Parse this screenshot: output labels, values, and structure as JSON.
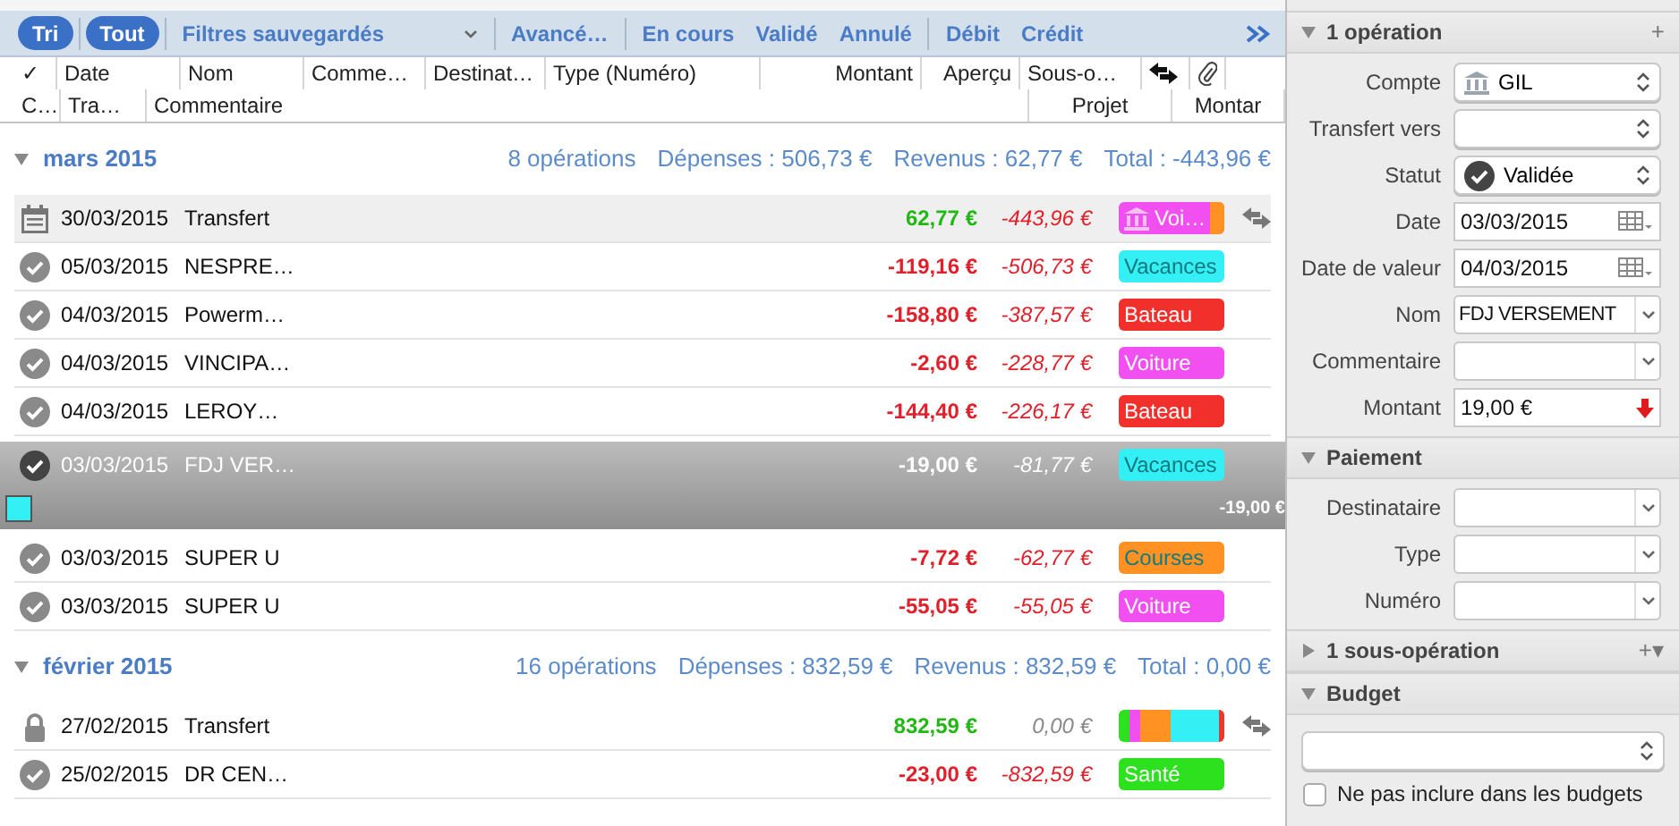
{
  "toolbar": {
    "filters": [
      {
        "label": "Tri",
        "kind": "pill",
        "selected": true
      },
      {
        "label": "Tout",
        "kind": "pill",
        "selected": true
      },
      {
        "label": "Filtres sauvegardés",
        "kind": "menu",
        "selected": false
      },
      {
        "label": "Avancé…",
        "kind": "text",
        "selected": false
      },
      {
        "label": "En cours",
        "kind": "text",
        "selected": false
      },
      {
        "label": "Validé",
        "kind": "text",
        "selected": false
      },
      {
        "label": "Annulé",
        "kind": "text",
        "selected": false
      },
      {
        "label": "Débit",
        "kind": "text",
        "selected": false
      },
      {
        "label": "Crédit",
        "kind": "text",
        "selected": false
      }
    ]
  },
  "columns": {
    "line_1": [
      {
        "label": "✓",
        "kind": "text"
      },
      {
        "label": "Date",
        "kind": "text"
      },
      {
        "label": "Nom",
        "kind": "text"
      },
      {
        "label": "Comme…",
        "kind": "text"
      },
      {
        "label": "Destinat…",
        "kind": "text"
      },
      {
        "label": "Type (Numéro)",
        "kind": "text"
      },
      {
        "label": "Montant",
        "kind": "text"
      },
      {
        "label": "Aperçu",
        "kind": "text"
      },
      {
        "label": "Sous-o…",
        "kind": "text"
      },
      {
        "kind": "transfer"
      },
      {
        "kind": "attachment"
      }
    ],
    "line_2": [
      {
        "label": "C…"
      },
      {
        "label": "Tra…"
      },
      {
        "label": "Commentaire"
      },
      {
        "label": "Projet"
      },
      {
        "label": "Montar"
      }
    ]
  },
  "groups": [
    {
      "title": "mars 2015",
      "expanded": true,
      "count": "8 opérations",
      "expenses": "Dépenses : 506,73 €",
      "income": "Revenus : 62,77 €",
      "total": "Total : -443,96 €",
      "rows": [
        {
          "kind": "calendar",
          "date": "30/03/2015",
          "name": "Transfert",
          "amount": "62,77 €",
          "credit": true,
          "balance": "-443,96 €",
          "balance_zero": false,
          "tag": {
            "kind": "account",
            "label": "Voi…",
            "color": "#f24ff0",
            "stripes": [
              {
                "color": "#ff9222",
                "kind": "edge"
              }
            ]
          },
          "transfer": true,
          "selected": false
        },
        {
          "kind": "check",
          "date": "05/03/2015",
          "name": "NESPRE…",
          "amount": "-119,16 €",
          "credit": false,
          "balance": "-506,73 €",
          "balance_zero": false,
          "tag": {
            "kind": "category",
            "label": "Vacances",
            "color": "#34f0f5"
          },
          "transfer": false,
          "selected": false
        },
        {
          "kind": "check",
          "date": "04/03/2015",
          "name": "Powerm…",
          "amount": "-158,80 €",
          "credit": false,
          "balance": "-387,57 €",
          "balance_zero": false,
          "tag": {
            "kind": "category",
            "label": "Bateau",
            "color": "#f1302b"
          },
          "transfer": false,
          "selected": false
        },
        {
          "kind": "check",
          "date": "04/03/2015",
          "name": "VINCIPA…",
          "amount": "-2,60 €",
          "credit": false,
          "balance": "-228,77 €",
          "balance_zero": false,
          "tag": {
            "kind": "category",
            "label": "Voiture",
            "color": "#f24ff0"
          },
          "transfer": false,
          "selected": false
        },
        {
          "kind": "check",
          "date": "04/03/2015",
          "name": "LEROY…",
          "amount": "-144,40 €",
          "credit": false,
          "balance": "-226,17 €",
          "balance_zero": false,
          "tag": {
            "kind": "category",
            "label": "Bateau",
            "color": "#f1302b"
          },
          "transfer": false,
          "selected": false
        },
        {
          "kind": "check",
          "date": "03/03/2015",
          "name": "FDJ VER…",
          "amount": "-19,00 €",
          "credit": false,
          "balance": "-81,77 €",
          "balance_zero": false,
          "tag": {
            "kind": "category",
            "label": "Vacances",
            "color": "#34f0f5"
          },
          "transfer": false,
          "selected": true,
          "detail": {
            "color": "#34f0f5",
            "amount": "-19,00 €"
          }
        },
        {
          "kind": "check",
          "date": "03/03/2015",
          "name": "SUPER U",
          "amount": "-7,72 €",
          "credit": false,
          "balance": "-62,77 €",
          "balance_zero": false,
          "tag": {
            "kind": "category",
            "label": "Courses",
            "color": "#ff9222"
          },
          "transfer": false,
          "selected": false
        },
        {
          "kind": "check",
          "date": "03/03/2015",
          "name": "SUPER U",
          "amount": "-55,05 €",
          "credit": false,
          "balance": "-55,05 €",
          "balance_zero": false,
          "tag": {
            "kind": "category",
            "label": "Voiture",
            "color": "#f24ff0"
          },
          "transfer": false,
          "selected": false
        }
      ]
    },
    {
      "title": "février 2015",
      "expanded": true,
      "count": "16 opérations",
      "expenses": "Dépenses : 832,59 €",
      "income": "Revenus : 832,59 €",
      "total": "Total : 0,00 €",
      "rows": [
        {
          "kind": "lock",
          "date": "27/02/2015",
          "name": "Transfert",
          "amount": "832,59 €",
          "credit": true,
          "balance": "0,00 €",
          "balance_zero": true,
          "tag": {
            "kind": "split",
            "stripes": [
              {
                "color": "#2de11f",
                "kind": "narrow"
              },
              {
                "color": "#f24ff0",
                "kind": "narrow"
              },
              {
                "color": "#ff9222",
                "kind": "medium"
              },
              {
                "color": "#34f0f5",
                "kind": "wide"
              },
              {
                "color": "#e8392e",
                "kind": "thin"
              }
            ]
          },
          "transfer": true,
          "selected": false
        },
        {
          "kind": "check",
          "date": "25/02/2015",
          "name": "DR CEN…",
          "amount": "-23,00 €",
          "credit": false,
          "balance": "-832,59 €",
          "balance_zero": false,
          "tag": {
            "kind": "category",
            "label": "Santé",
            "color": "#2de11f"
          },
          "transfer": false,
          "selected": false
        }
      ]
    }
  ],
  "inspector": [
    {
      "title": "1 opération",
      "expanded": true,
      "action": "+",
      "fields": [
        {
          "label": "Compte",
          "kind": "account",
          "value": "GIL"
        },
        {
          "label": "Transfert vers",
          "kind": "popup"
        },
        {
          "label": "Statut",
          "kind": "status",
          "value": "Validée"
        },
        {
          "label": "Date",
          "kind": "date",
          "value": "03/03/2015"
        },
        {
          "label": "Date de valeur",
          "kind": "date",
          "value": "04/03/2015"
        },
        {
          "label": "Nom",
          "kind": "combo",
          "value": "FDJ VERSEMENT"
        },
        {
          "label": "Commentaire",
          "kind": "combo"
        },
        {
          "label": "Montant",
          "kind": "amount",
          "value": "19,00 €"
        }
      ]
    },
    {
      "title": "Paiement",
      "expanded": true,
      "fields": [
        {
          "label": "Destinataire",
          "kind": "combo"
        },
        {
          "label": "Type",
          "kind": "combo"
        },
        {
          "label": "Numéro",
          "kind": "combo"
        }
      ]
    },
    {
      "title": "1 sous-opération",
      "expanded": false,
      "action": "+▾"
    },
    {
      "title": "Budget",
      "expanded": true,
      "fields": [
        {
          "kind": "popup"
        }
      ],
      "checkbox": {
        "label": "Ne pas inclure dans les budgets",
        "checked": false
      }
    }
  ]
}
